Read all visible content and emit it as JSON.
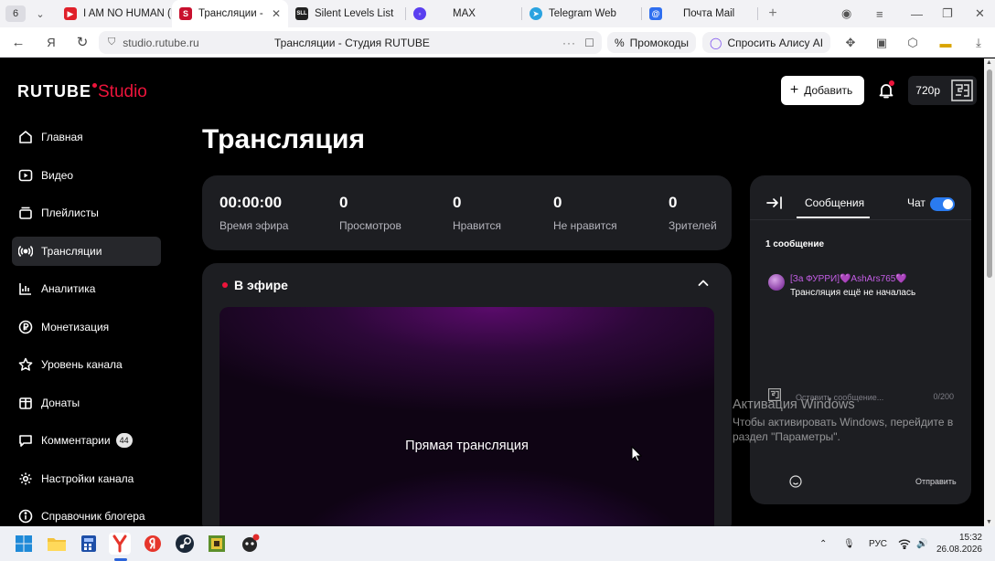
{
  "browser": {
    "tab_counter": "6",
    "tabs": [
      {
        "title": "I AM NO HUMAN (In",
        "active": false
      },
      {
        "title": "Трансляции - Сту",
        "active": true
      },
      {
        "title": "Silent Levels List",
        "active": false
      },
      {
        "title": "MAX",
        "active": false
      },
      {
        "title": "Telegram Web",
        "active": false
      },
      {
        "title": "Почта Mail",
        "active": false
      }
    ],
    "url": "studio.rutube.ru",
    "page_title": "Трансляции - Студия RUTUBE",
    "promo_label": "Промокоды",
    "alice_label": "Спросить Алису AI"
  },
  "app": {
    "logo_main": "RUTUBE",
    "logo_sub": "Studio",
    "add_button": "Добавить",
    "quality": "720p",
    "page_heading": "Трансляция",
    "sidebar": [
      {
        "label": "Главная",
        "icon": "home-icon"
      },
      {
        "label": "Видео",
        "icon": "video-icon"
      },
      {
        "label": "Плейлисты",
        "icon": "playlist-icon"
      },
      {
        "label": "Трансляции",
        "icon": "broadcast-icon",
        "active": true
      },
      {
        "label": "Аналитика",
        "icon": "analytics-icon"
      },
      {
        "label": "Монетизация",
        "icon": "monetization-icon"
      },
      {
        "label": "Уровень канала",
        "icon": "star-icon"
      },
      {
        "label": "Донаты",
        "icon": "donate-icon"
      },
      {
        "label": "Комментарии",
        "icon": "comments-icon",
        "badge": "44"
      },
      {
        "label": "Настройки канала",
        "icon": "settings-icon"
      },
      {
        "label": "Справочник блогера",
        "icon": "info-icon"
      }
    ],
    "stats": [
      {
        "value": "00:00:00",
        "label": "Время эфира"
      },
      {
        "value": "0",
        "label": "Просмотров"
      },
      {
        "value": "0",
        "label": "Нравится"
      },
      {
        "value": "0",
        "label": "Не нравится"
      },
      {
        "value": "0",
        "label": "Зрителей"
      }
    ],
    "live": {
      "heading": "В эфире",
      "player_text": "Прямая трансляция"
    },
    "chat": {
      "tab_label": "Сообщения",
      "toggle_label": "Чат",
      "toggle_on": true,
      "message_count": "1 сообщение",
      "messages": [
        {
          "author": "[За ФУРРИ]💜AshArs765💜",
          "text": "Трансляция ещё не началась"
        }
      ],
      "input_placeholder": "Оставить сообщение...",
      "char_count": "0/200",
      "send_label": "Отправить"
    }
  },
  "windows_activation": {
    "title": "Активация Windows",
    "line1": "Чтобы активировать Windows, перейдите в",
    "line2": "раздел \"Параметры\"."
  },
  "taskbar": {
    "lang": "РУС",
    "time": "15:32",
    "date": "26.08.2026"
  },
  "colors": {
    "accent_red": "#ed143b",
    "toggle_blue": "#2a7bf0",
    "card_bg": "#1d1e22"
  }
}
